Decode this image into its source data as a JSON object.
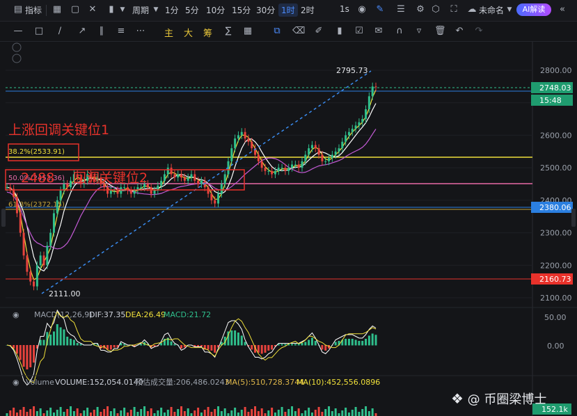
{
  "toolbar": {
    "indicators_label": "指标",
    "period_label": "周期",
    "intervals": [
      "1分",
      "5分",
      "10分",
      "15分",
      "30分",
      "1时",
      "2时"
    ],
    "active_interval": "1时",
    "second_label": "1s",
    "cloud_label": "未命名",
    "ai_label": "AI解读"
  },
  "drawing_toolbar": {
    "labels": [
      "主",
      "大",
      "筹"
    ]
  },
  "annotations": {
    "text1": "上涨回调关键位1",
    "text2a": "2488",
    "text2b": "回调关键位2"
  },
  "fib_levels": [
    {
      "label": "38.2%(2533.91)",
      "price": 2533.91,
      "color": "#f0e03a"
    },
    {
      "label": "50.0%(2453.36)",
      "price": 2453.36,
      "color": "#e86aa6"
    },
    {
      "label": "61.8%(2372.15)",
      "price": 2372.15,
      "color": "#c4a23a"
    }
  ],
  "price_tags": [
    {
      "label": "2748.03",
      "price": 2748.03,
      "color": "#1f9c6f"
    },
    {
      "label": "15:48",
      "price": 2728,
      "color": "#1f9c6f"
    },
    {
      "label": "2380.06",
      "price": 2380.06,
      "color": "#2b7fe0"
    },
    {
      "label": "2160.73",
      "price": 2160.73,
      "color": "#e8322b"
    }
  ],
  "high_label": "2795.73",
  "low_label": "2111.00",
  "macd_legend": {
    "name": "MACD(12,26,9)",
    "dif": "DIF:37.35",
    "dea": "DEA:26.49",
    "macd": "MACD:21.72"
  },
  "volume_legend": {
    "name": "Volume",
    "volume": "VOLUME:152,054.0140",
    "est": "预估成交量:206,486.0243",
    "ma5": "MA(5):510,728.3744",
    "ma10": "MA(10):452,556.0896"
  },
  "volume_tag": "152.1k",
  "watermark": "@ 币圈梁博士",
  "chart_data": {
    "type": "candlestick",
    "price_axis_ticks": [
      2800,
      2700,
      2600,
      2500,
      2400,
      2300,
      2200,
      2100
    ],
    "ylim": [
      2085,
      2830
    ],
    "macd_axis_ticks": [
      "50.00",
      "0.00"
    ],
    "high": 2795.73,
    "low": 2111.0,
    "last_price": 2748.03,
    "fib_lines": [
      2533.91,
      2453.36,
      2372.15
    ],
    "horizontal_lines": [
      2748.03,
      2380.06,
      2160.73
    ],
    "close_path": [
      2440,
      2435,
      2410,
      2360,
      2300,
      2230,
      2180,
      2150,
      2135,
      2200,
      2230,
      2200,
      2260,
      2300,
      2360,
      2400,
      2430,
      2450,
      2440,
      2460,
      2480,
      2470,
      2450,
      2460,
      2480,
      2470,
      2460,
      2470,
      2450,
      2440,
      2420,
      2430,
      2430,
      2420,
      2440,
      2440,
      2430,
      2420,
      2430,
      2440,
      2440,
      2450,
      2440,
      2420,
      2430,
      2445,
      2460,
      2480,
      2500,
      2480,
      2470,
      2480,
      2470,
      2460,
      2470,
      2480,
      2460,
      2450,
      2460,
      2440,
      2420,
      2400,
      2390,
      2420,
      2450,
      2480,
      2520,
      2560,
      2590,
      2600,
      2610,
      2590,
      2580,
      2560,
      2540,
      2520,
      2500,
      2490,
      2490,
      2480,
      2490,
      2500,
      2500,
      2490,
      2500,
      2510,
      2510,
      2500,
      2520,
      2540,
      2560,
      2570,
      2560,
      2540,
      2520,
      2520,
      2530,
      2540,
      2550,
      2560,
      2580,
      2600,
      2610,
      2620,
      2630,
      2640,
      2650,
      2680,
      2720,
      2750,
      2748
    ]
  }
}
